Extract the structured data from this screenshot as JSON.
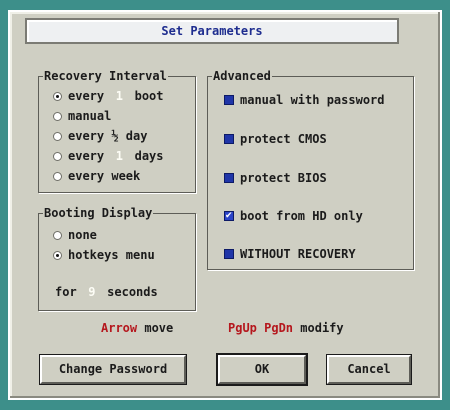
{
  "dialog": {
    "title": "Set Parameters"
  },
  "recovery_interval": {
    "legend": "Recovery Interval",
    "options": [
      {
        "pre": "every",
        "field": "1",
        "post": "boot",
        "selected": true
      },
      {
        "pre": "manual",
        "field": "",
        "post": "",
        "selected": false
      },
      {
        "pre": "every ½ day",
        "field": "",
        "post": "",
        "selected": false
      },
      {
        "pre": "every",
        "field": "1",
        "post": "days",
        "selected": false
      },
      {
        "pre": "every week",
        "field": "",
        "post": "",
        "selected": false
      }
    ]
  },
  "booting_display": {
    "legend": "Booting Display",
    "options": [
      {
        "label": "none",
        "selected": false
      },
      {
        "label": "hotkeys menu",
        "selected": true
      }
    ],
    "timeout": {
      "pre": "for",
      "value": "9",
      "post": "seconds"
    }
  },
  "advanced": {
    "legend": "Advanced",
    "options": [
      {
        "label": "manual with password",
        "checked": false
      },
      {
        "label": "protect CMOS",
        "checked": false
      },
      {
        "label": "protect BIOS",
        "checked": false
      },
      {
        "label": "boot from HD only",
        "checked": true
      },
      {
        "label": "WITHOUT RECOVERY",
        "checked": false
      }
    ]
  },
  "hints": {
    "arrow_key": "Arrow",
    "arrow_text": "move",
    "pg_keys": "PgUp PgDn",
    "pg_text": "modify"
  },
  "buttons": {
    "change_password": "Change Password",
    "ok": "OK",
    "cancel": "Cancel"
  },
  "colors": {
    "background": "#3d8f8a",
    "dialog": "#cfcfc3",
    "title_text": "#1e2d8f",
    "hint_key": "#b5171d",
    "checkbox": "#1f35a8"
  }
}
